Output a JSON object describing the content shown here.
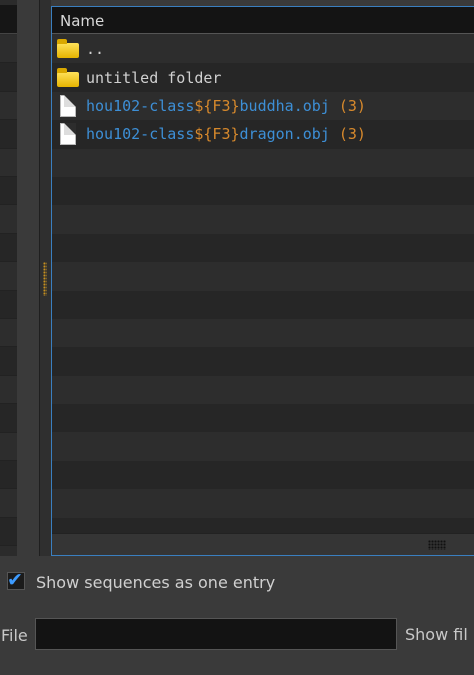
{
  "file_list": {
    "header": "Name",
    "items": [
      {
        "type": "folder",
        "parts": [
          {
            "text": "..",
            "color": "plain"
          }
        ]
      },
      {
        "type": "folder",
        "parts": [
          {
            "text": "untitled folder",
            "color": "plain"
          }
        ]
      },
      {
        "type": "file",
        "parts": [
          {
            "text": "hou102-class",
            "color": "blue"
          },
          {
            "text": "${F3}",
            "color": "orange"
          },
          {
            "text": "buddha.obj",
            "color": "blue"
          },
          {
            "text": " (3)",
            "color": "orange"
          }
        ]
      },
      {
        "type": "file",
        "parts": [
          {
            "text": "hou102-class",
            "color": "blue"
          },
          {
            "text": "${F3}",
            "color": "orange"
          },
          {
            "text": "dragon.obj",
            "color": "blue"
          },
          {
            "text": " (3)",
            "color": "orange"
          }
        ]
      }
    ]
  },
  "options": {
    "show_sequences_label": "Show sequences as one entry",
    "show_sequences_checked": true
  },
  "file_field": {
    "label": "File",
    "value": ""
  },
  "show_files_button": "Show fil",
  "colors": {
    "accent_border": "#3a7fc0",
    "link_blue": "#3d8fd6",
    "variable_orange": "#d7892c",
    "folder_yellow": "#ffe25a"
  }
}
